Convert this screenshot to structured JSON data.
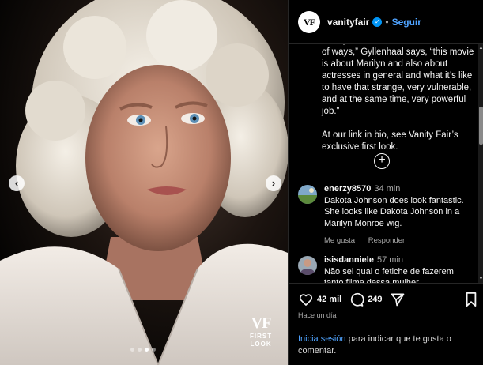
{
  "post": {
    "username": "vanityfair",
    "avatar_text": "VF",
    "follow_label": "Seguir",
    "separator": "•"
  },
  "media": {
    "watermark_logo": "VF",
    "watermark_line1": "FIRST",
    "watermark_line2": "LOOK",
    "carousel_count": 4,
    "carousel_active_index": 2,
    "prev_icon": "chevron-left-icon",
    "next_icon": "chevron-right-icon"
  },
  "caption": {
    "paragraph1": "Burstyn and Dakota Johnson. “In a lot of ways,” Gyllenhaal says, “this movie is about Marilyn and also about actresses in general and what it’s like to have that strange, very vulnerable, and at the same time, very powerful job.”",
    "paragraph2": "At our link in bio, see Vanity Fair’s exclusive first look.",
    "load_more_icon": "plus-circle-icon"
  },
  "comments": [
    {
      "user": "enerzy8570",
      "time": "34 min",
      "text": "Dakota Johnson does look fantastic. She looks like Dakota Johnson in a Marilyn Monroe wig.",
      "like_label": "Me gusta",
      "reply_label": "Responder"
    },
    {
      "user": "isisdanniele",
      "time": "57 min",
      "text": "Não sei qual o fetiche de fazerem tanto filme dessa mulher."
    }
  ],
  "actions": {
    "likes": "42 mil",
    "comments": "249",
    "posted": "Hace un día",
    "login_link": "Inicia sesión",
    "login_text": " para indicar que te gusta o comentar."
  },
  "colors": {
    "background": "#000000",
    "link_blue": "#4fa3ff",
    "verified_blue": "#0095f6",
    "muted_text": "#a8a8a8"
  }
}
